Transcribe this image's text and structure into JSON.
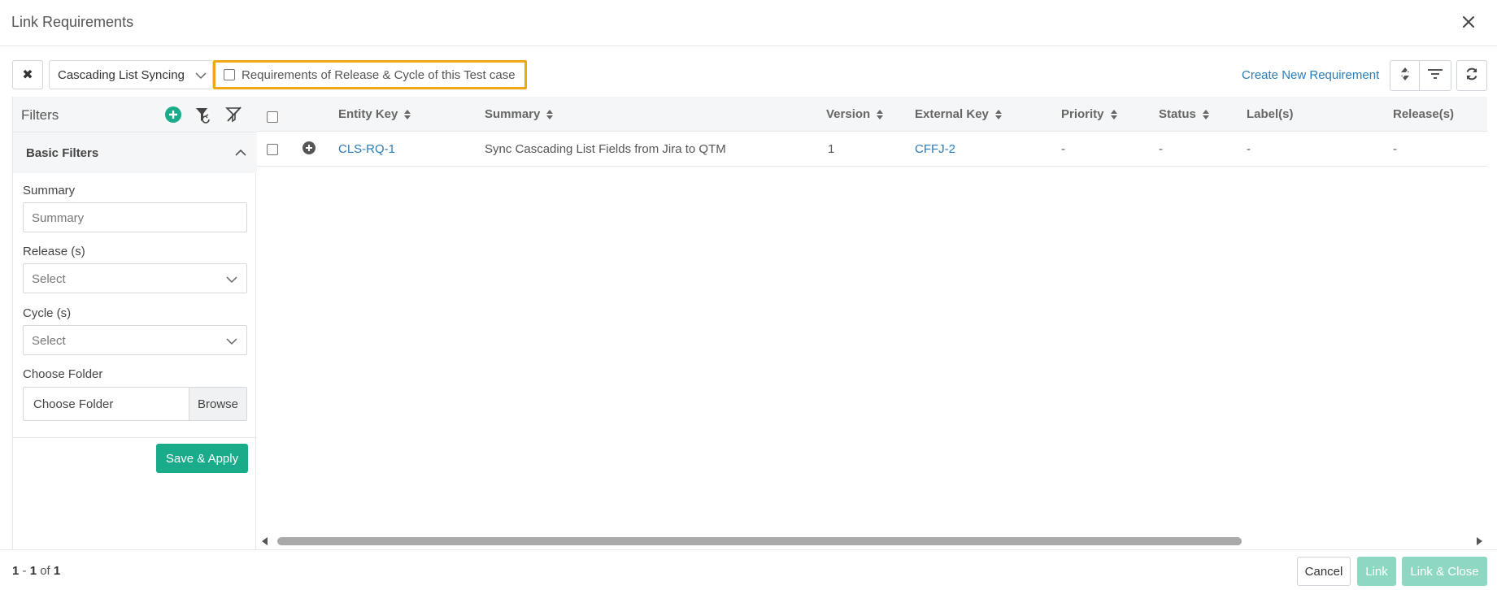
{
  "dialog": {
    "title": "Link Requirements"
  },
  "toolbar": {
    "project": "Cascading List Syncing",
    "toggle_label": "Requirements of Release & Cycle of this Test case",
    "create_link": "Create New Requirement"
  },
  "sidebar": {
    "title": "Filters",
    "section": "Basic Filters",
    "summary": {
      "label": "Summary",
      "placeholder": "Summary"
    },
    "release": {
      "label": "Release (s)",
      "placeholder": "Select"
    },
    "cycle": {
      "label": "Cycle (s)",
      "placeholder": "Select"
    },
    "folder": {
      "label": "Choose Folder",
      "value": "Choose Folder",
      "browse": "Browse"
    },
    "save": "Save & Apply"
  },
  "table": {
    "columns": [
      "Entity Key",
      "Summary",
      "Version",
      "External Key",
      "Priority",
      "Status",
      "Label(s)",
      "Release(s)"
    ],
    "rows": [
      {
        "entity_key": "CLS-RQ-1",
        "summary": "Sync Cascading List Fields from Jira to QTM",
        "version": "1",
        "external_key": "CFFJ-2",
        "priority": "-",
        "status": "-",
        "labels": "-",
        "releases": "-"
      }
    ]
  },
  "footer": {
    "range_start": "1",
    "range_end": "1",
    "of_word": "of",
    "total": "1",
    "cancel": "Cancel",
    "link": "Link",
    "link_close": "Link & Close"
  },
  "colors": {
    "accent": "#1aab8a",
    "disabled_accent": "#8ed7c3",
    "link": "#2b7bb9",
    "highlight": "#f0a616"
  }
}
